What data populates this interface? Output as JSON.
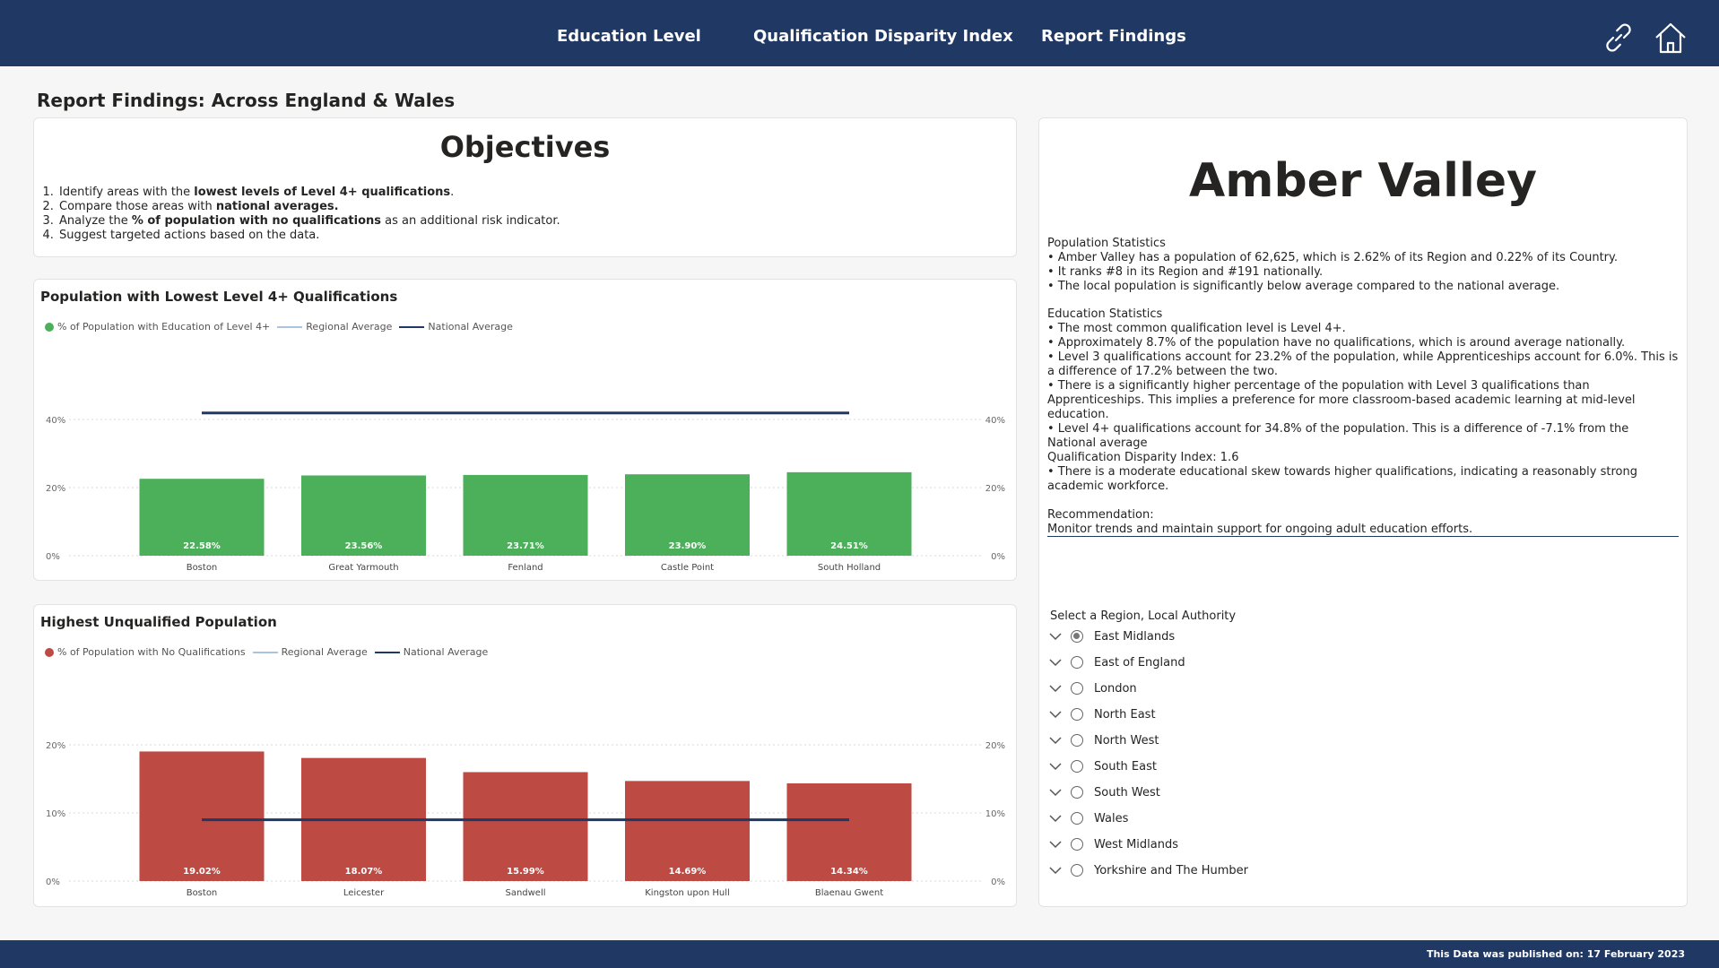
{
  "nav": {
    "items": [
      "Education Level",
      "Qualification Disparity Index",
      "Report Findings"
    ],
    "icons": [
      "link-icon",
      "home-icon"
    ]
  },
  "page_title": "Report Findings: Across England & Wales",
  "objectives": {
    "title": "Objectives",
    "items": [
      {
        "before": "Identify areas with the ",
        "bold": "lowest levels of Level 4+ qualifications",
        "after": "."
      },
      {
        "before": "Compare those areas with ",
        "bold": "national averages.",
        "after": ""
      },
      {
        "before": "Analyze the ",
        "bold": "% of population with no qualifications",
        "after": " as an additional risk indicator."
      },
      {
        "before": "Suggest targeted actions based on the data.",
        "bold": "",
        "after": ""
      }
    ]
  },
  "chart_data": [
    {
      "type": "bar",
      "title": "Population with Lowest Level 4+ Qualifications",
      "legend": [
        "% of Population with Education of Level 4+",
        "Regional Average",
        "National Average"
      ],
      "categories": [
        "Boston",
        "Great Yarmouth",
        "Fenland",
        "Castle Point",
        "South Holland"
      ],
      "series": [
        {
          "name": "% of Population with Education of Level 4+",
          "values": [
            22.58,
            23.56,
            23.71,
            23.9,
            24.51
          ],
          "labels": [
            "22.58%",
            "23.56%",
            "23.71%",
            "23.90%",
            "24.51%"
          ],
          "color": "#4caf5a"
        },
        {
          "name": "National Average",
          "type": "line",
          "values": [
            41.9,
            41.9,
            41.9,
            41.9,
            41.9
          ],
          "color": "#1f3864"
        }
      ],
      "yticks": [
        "0%",
        "20%",
        "40%"
      ],
      "ylim": [
        0,
        50
      ],
      "grid": true
    },
    {
      "type": "bar",
      "title": "Highest Unqualified Population",
      "legend": [
        "% of Population with No Qualifications",
        "Regional Average",
        "National Average"
      ],
      "categories": [
        "Boston",
        "Leicester",
        "Sandwell",
        "Kingston upon Hull",
        "Blaenau Gwent"
      ],
      "series": [
        {
          "name": "% of Population with No Qualifications",
          "values": [
            19.02,
            18.07,
            15.99,
            14.69,
            14.34
          ],
          "labels": [
            "19.02%",
            "18.07%",
            "15.99%",
            "14.69%",
            "14.34%"
          ],
          "color": "#bd4a43"
        },
        {
          "name": "National Average",
          "type": "line",
          "values": [
            9.0,
            9.0,
            9.0,
            9.0,
            9.0
          ],
          "color": "#1f3864"
        }
      ],
      "yticks": [
        "0%",
        "10%",
        "20%"
      ],
      "ylim": [
        0,
        25
      ],
      "grid": true
    }
  ],
  "colors": {
    "nav_bg": "#1f3864",
    "green": "#4caf5a",
    "red": "#bd4a43",
    "national_line": "#1f3864",
    "regional_line": "#a9c4df"
  },
  "panel": {
    "title": "Amber Valley",
    "paragraphs": [
      [
        "Population Statistics",
        "• Amber Valley has a population of 62,625, which is 2.62% of its Region and 0.22% of its Country.",
        "• It ranks #8 in its Region and #191 nationally.",
        "• The local population is significantly below average compared to the national average."
      ],
      [
        "Education Statistics",
        "• The most common qualification level is Level 4+.",
        "• Approximately 8.7% of the population have no qualifications, which is around average nationally.",
        "• Level 3 qualifications account for 23.2% of the population, while Apprenticeships account for 6.0%. This is a difference of 17.2% between the two.",
        "• There is a significantly higher percentage of the population with Level 3 qualifications than Apprenticeships. This implies a preference for more classroom-based academic learning at mid-level education.",
        "• Level 4+ qualifications account for 34.8% of the population. This is a difference of -7.1% from the National average"
      ],
      [
        "Qualification Disparity Index: 1.6",
        "• There is a moderate educational skew towards higher qualifications, indicating a reasonably strong academic workforce."
      ],
      [
        "Recommendation:",
        "Monitor trends and maintain support for ongoing adult education efforts."
      ]
    ]
  },
  "slicer": {
    "title": "Select a Region, Local Authority",
    "selected": "East Midlands",
    "regions": [
      "East Midlands",
      "East of England",
      "London",
      "North East",
      "North West",
      "South East",
      "South West",
      "Wales",
      "West Midlands",
      "Yorkshire and The Humber"
    ]
  },
  "footer": {
    "text": "This Data was published on: 17 February 2023"
  }
}
